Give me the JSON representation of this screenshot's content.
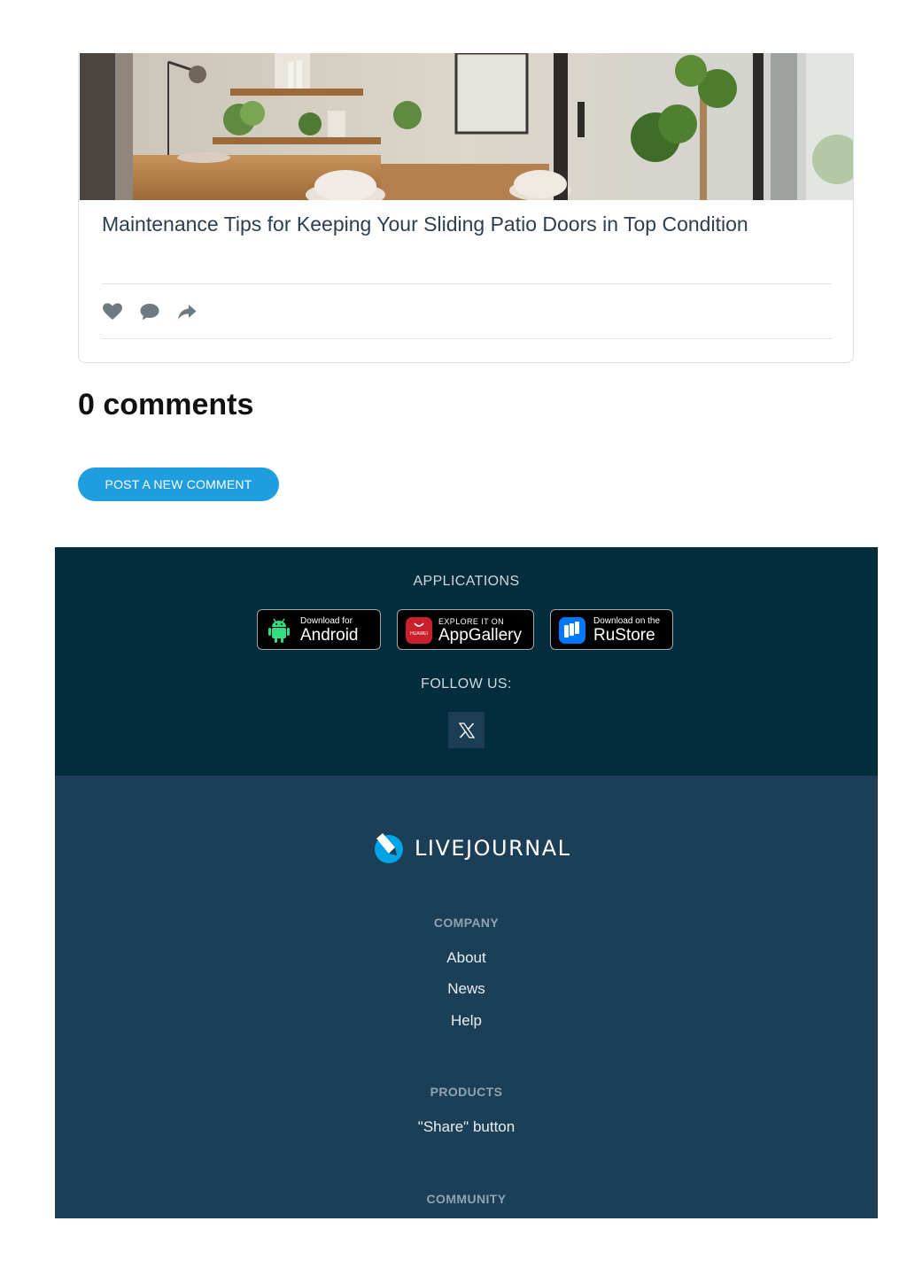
{
  "post": {
    "title": "Maintenance Tips for Keeping Your Sliding Patio Doors in Top Condition",
    "actions": [
      "heart-icon",
      "comment-icon",
      "share-arrow-icon"
    ]
  },
  "comments": {
    "heading": "0 comments",
    "post_button": "POST A NEW COMMENT"
  },
  "footer": {
    "applications": {
      "heading": "APPLICATIONS",
      "badges": [
        {
          "small": "Download for",
          "big": "Android",
          "icon": "android-icon"
        },
        {
          "tiny": "HUAWEI",
          "small": "EXPLORE IT ON",
          "big": "AppGallery",
          "icon": "huawei-appgallery-icon"
        },
        {
          "small": "Download on the",
          "big": "RuStore",
          "icon": "rustore-icon"
        }
      ]
    },
    "follow": {
      "heading": "FOLLOW US:",
      "social": "x-icon"
    },
    "brand": "LIVEJOURNAL",
    "sections": [
      {
        "title": "COMPANY",
        "links": [
          "About",
          "News",
          "Help"
        ]
      },
      {
        "title": "PRODUCTS",
        "links": [
          "\"Share\" button"
        ]
      },
      {
        "title": "COMMUNITY",
        "links": []
      }
    ]
  },
  "colors": {
    "accent_button": "#1e9ede",
    "footer_dark": "#012d3c",
    "footer_mid": "#1b3f56",
    "section_title": "#8ea3b3"
  }
}
